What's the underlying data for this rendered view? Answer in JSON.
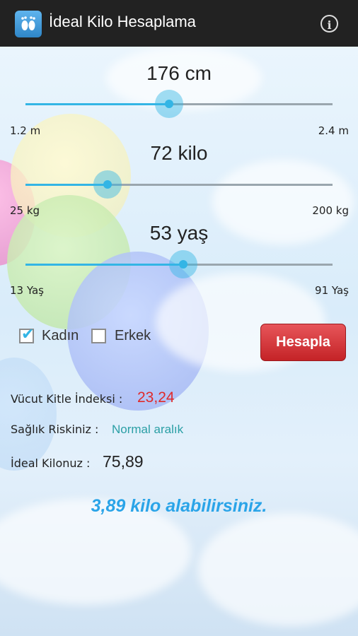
{
  "app": {
    "title": "İdeal Kilo Hesaplama",
    "icon": "footprints-icon",
    "info_icon": "info-icon"
  },
  "height": {
    "value_label": "176 cm",
    "min": "1.2 m",
    "max": "2.4 m",
    "fraction": 0.467
  },
  "weight": {
    "value_label": "72 kilo",
    "min": "25 kg",
    "max": "200 kg",
    "fraction": 0.268
  },
  "age": {
    "value_label": "53 yaş",
    "min": "13 Yaş",
    "max": "91 Yaş",
    "fraction": 0.513
  },
  "gender": {
    "female_label": "Kadın",
    "female_checked": true,
    "male_label": "Erkek",
    "male_checked": false
  },
  "calculate_label": "Hesapla",
  "results": {
    "bmi_label": "Vücut Kitle İndeksi :",
    "bmi_value": "23,24",
    "risk_label": "Sağlık Riskiniz :",
    "risk_value": "Normal aralık",
    "ideal_label": "İdeal Kilonuz :",
    "ideal_value": "75,89",
    "summary": "3,89 kilo alabilirsiniz."
  },
  "colors": {
    "accent": "#33b5e5",
    "bmi": "#e02a2a",
    "risk": "#2a9fa5",
    "summary": "#2aa4e8",
    "button": "#d0343a"
  }
}
